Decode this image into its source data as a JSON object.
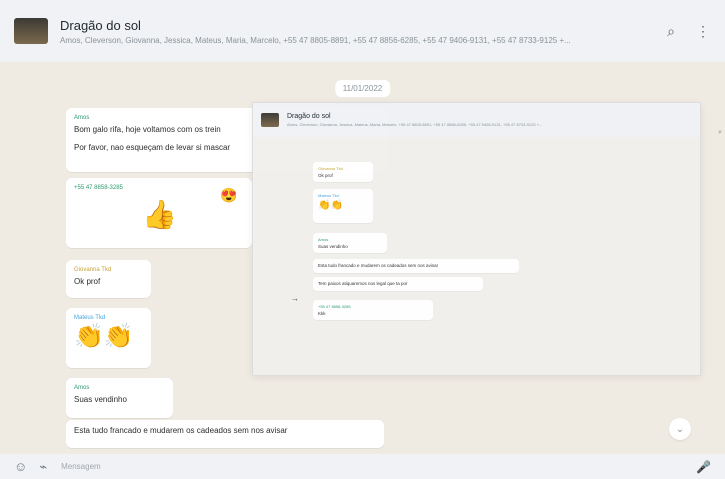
{
  "header": {
    "title": "Dragão do sol",
    "members": "Amos, Cleverson, Giovanna, Jessica, Mateus, Maria, Marcelo, +55 47 8805-8891, +55 47 8856-6285, +55 47 9406-9131, +55 47 8733-9125 +..."
  },
  "chat": {
    "date": "11/01/2022",
    "messages": [
      {
        "sender": "Amos",
        "text_1": "Bom galo rifa, hoje voltamos com os trein",
        "text_2": "Por favor, nao esqueçam de levar si mascar",
        "time": ""
      },
      {
        "sender": "+55 47 8858-3285",
        "text": "👍",
        "reaction": "😍",
        "time": ""
      },
      {
        "sender": "Giovanna Tkd",
        "text": "Ok prof",
        "time": ""
      },
      {
        "sender": "Mateus Tkd",
        "text": "👏👏",
        "time": ""
      },
      {
        "sender": "Amos",
        "text": "Suas vendinho",
        "time": ""
      },
      {
        "sender": "",
        "text": "Esta tudo francado e mudarem os cadeados sem nos avisar",
        "time": ""
      }
    ]
  },
  "overlay": {
    "title": "Dragão do sol",
    "members": "Amos, Cleverson, Giovanna, Jessica, Mateus, Maria, Marcelo, +55 47 8805-8891, +55 47 8856-6285, +55 47 9406-9131, +55 47 8733-9125 +...",
    "messages": [
      {
        "sender": "Giovanna Tkd",
        "text": "Ok prof"
      },
      {
        "sender": "Mateus Tkd",
        "text": "👏👏"
      },
      {
        "sender": "Amos",
        "text": "Suas vendinho"
      },
      {
        "sender": "",
        "text": "Esta tudo francado e mudarem os cadeados sem nos avisar"
      },
      {
        "sender": "",
        "text": "Tem paixos atiquaremos nos legal que ta por"
      },
      {
        "sender": "+55 47 8858-3285",
        "text": "Kkk"
      }
    ]
  },
  "composer": {
    "placeholder": "Mensagem"
  },
  "icons": {
    "search": "search-icon",
    "menu": "kebab-menu-icon",
    "emoji": "emoji-icon",
    "attach": "attach-icon",
    "mic": "mic-icon",
    "scroll": "chevron-down-icon"
  }
}
